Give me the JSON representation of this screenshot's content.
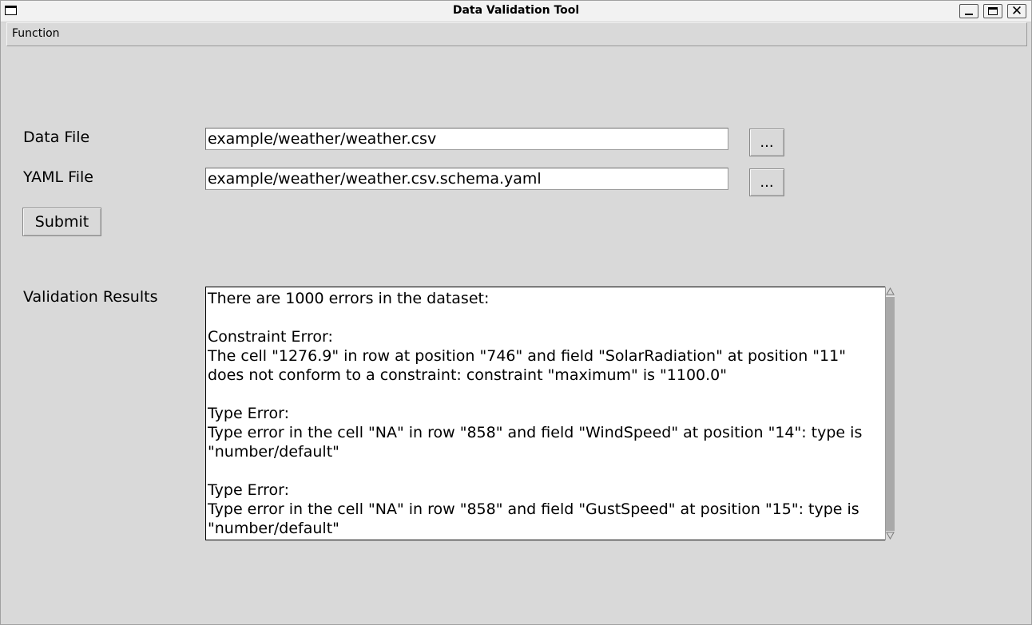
{
  "window": {
    "title": "Data Validation Tool",
    "close_glyph": "✕"
  },
  "menu": {
    "items": [
      "Function"
    ]
  },
  "form": {
    "data_file": {
      "label": "Data File",
      "value": "example/weather/weather.csv",
      "browse_label": "..."
    },
    "yaml_file": {
      "label": "YAML File",
      "value": "example/weather/weather.csv.schema.yaml",
      "browse_label": "..."
    },
    "submit_label": "Submit"
  },
  "results": {
    "label": "Validation Results",
    "text": "There are 1000 errors in the dataset:\n\nConstraint Error:\nThe cell \"1276.9\" in row at position \"746\" and field \"SolarRadiation\" at position \"11\" does not conform to a constraint: constraint \"maximum\" is \"1100.0\"\n\nType Error:\nType error in the cell \"NA\" in row \"858\" and field \"WindSpeed\" at position \"14\": type is \"number/default\"\n\nType Error:\nType error in the cell \"NA\" in row \"858\" and field \"GustSpeed\" at position \"15\": type is \"number/default\""
  },
  "icons": {
    "window_icon": "window-icon",
    "minimize": "minimize-icon",
    "maximize": "maximize-icon",
    "close": "close-icon",
    "scroll_up": "scroll-up-arrow-icon",
    "scroll_down": "scroll-down-arrow-icon"
  }
}
